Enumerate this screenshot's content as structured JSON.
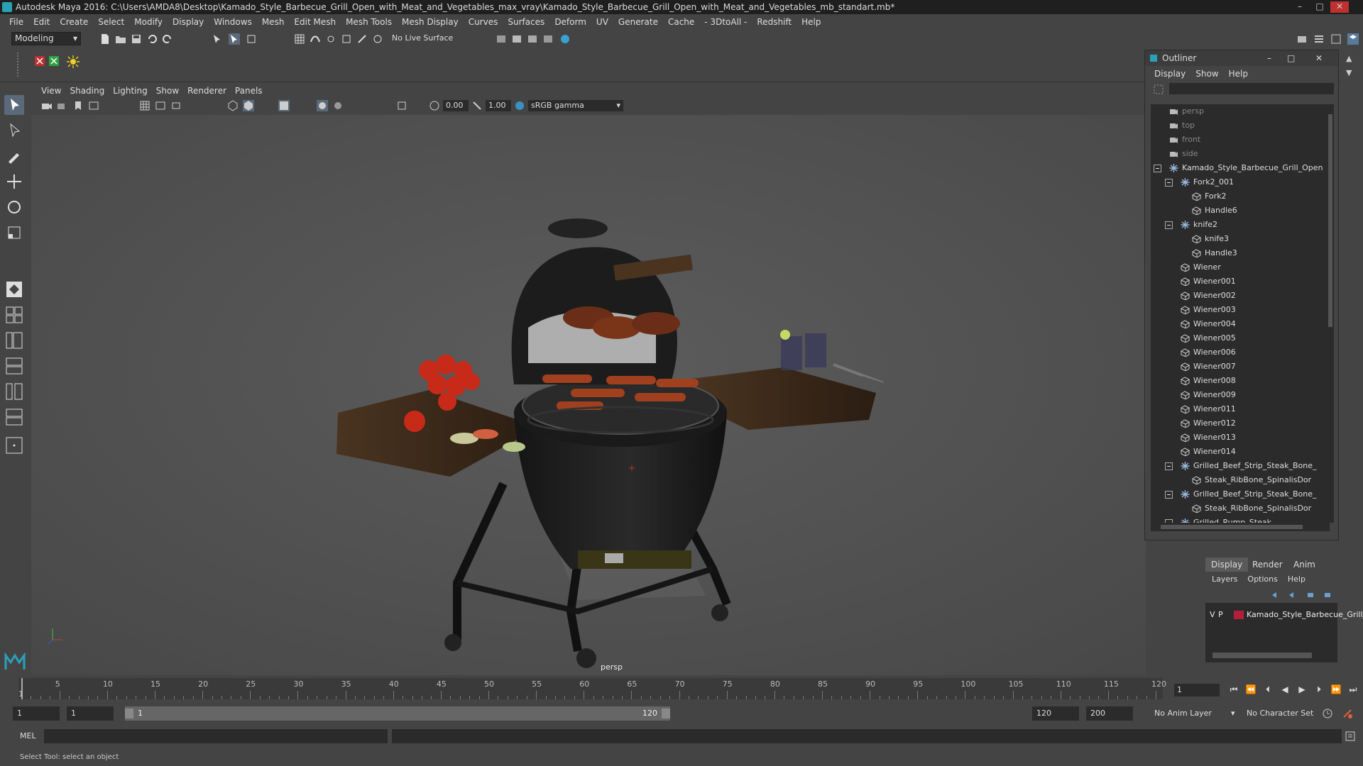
{
  "titlebar": {
    "title": "Autodesk Maya 2016: C:\\Users\\AMDA8\\Desktop\\Kamado_Style_Barbecue_Grill_Open_with_Meat_and_Vegetables_max_vray\\Kamado_Style_Barbecue_Grill_Open_with_Meat_and_Vegetables_mb_standart.mb*",
    "minimize": "–",
    "maximize": "□",
    "close": "✕"
  },
  "menubar": [
    "File",
    "Edit",
    "Create",
    "Select",
    "Modify",
    "Display",
    "Windows",
    "Mesh",
    "Edit Mesh",
    "Mesh Tools",
    "Mesh Display",
    "Curves",
    "Surfaces",
    "Deform",
    "UV",
    "Generate",
    "Cache",
    "- 3DtoAll -",
    "Redshift",
    "Help"
  ],
  "statusline": {
    "mode": "Modeling",
    "live_surface": "No Live Surface"
  },
  "viewport": {
    "menu": [
      "View",
      "Shading",
      "Lighting",
      "Show",
      "Renderer",
      "Panels"
    ],
    "exposure": "0.00",
    "gamma": "1.00",
    "color_space": "sRGB gamma",
    "camera_label": "persp"
  },
  "outliner": {
    "title": "Outliner",
    "menu": [
      "Display",
      "Show",
      "Help"
    ],
    "items": [
      {
        "label": "persp",
        "indent": 0,
        "type": "camera",
        "dim": true
      },
      {
        "label": "top",
        "indent": 0,
        "type": "camera",
        "dim": true
      },
      {
        "label": "front",
        "indent": 0,
        "type": "camera",
        "dim": true
      },
      {
        "label": "side",
        "indent": 0,
        "type": "camera",
        "dim": true
      },
      {
        "label": "Kamado_Style_Barbecue_Grill_Open",
        "indent": 0,
        "type": "group",
        "expanded": true
      },
      {
        "label": "Fork2_001",
        "indent": 1,
        "type": "group",
        "expanded": true
      },
      {
        "label": "Fork2",
        "indent": 2,
        "type": "mesh"
      },
      {
        "label": "Handle6",
        "indent": 2,
        "type": "mesh"
      },
      {
        "label": "knife2",
        "indent": 1,
        "type": "group",
        "expanded": true
      },
      {
        "label": "knife3",
        "indent": 2,
        "type": "mesh"
      },
      {
        "label": "Handle3",
        "indent": 2,
        "type": "mesh"
      },
      {
        "label": "Wiener",
        "indent": 1,
        "type": "mesh"
      },
      {
        "label": "Wiener001",
        "indent": 1,
        "type": "mesh"
      },
      {
        "label": "Wiener002",
        "indent": 1,
        "type": "mesh"
      },
      {
        "label": "Wiener003",
        "indent": 1,
        "type": "mesh"
      },
      {
        "label": "Wiener004",
        "indent": 1,
        "type": "mesh"
      },
      {
        "label": "Wiener005",
        "indent": 1,
        "type": "mesh"
      },
      {
        "label": "Wiener006",
        "indent": 1,
        "type": "mesh"
      },
      {
        "label": "Wiener007",
        "indent": 1,
        "type": "mesh"
      },
      {
        "label": "Wiener008",
        "indent": 1,
        "type": "mesh"
      },
      {
        "label": "Wiener009",
        "indent": 1,
        "type": "mesh"
      },
      {
        "label": "Wiener011",
        "indent": 1,
        "type": "mesh"
      },
      {
        "label": "Wiener012",
        "indent": 1,
        "type": "mesh"
      },
      {
        "label": "Wiener013",
        "indent": 1,
        "type": "mesh"
      },
      {
        "label": "Wiener014",
        "indent": 1,
        "type": "mesh"
      },
      {
        "label": "Grilled_Beef_Strip_Steak_Bone_",
        "indent": 1,
        "type": "group",
        "expanded": true
      },
      {
        "label": "Steak_RibBone_SpinalisDor",
        "indent": 2,
        "type": "mesh"
      },
      {
        "label": "Grilled_Beef_Strip_Steak_Bone_",
        "indent": 1,
        "type": "group",
        "expanded": true
      },
      {
        "label": "Steak_RibBone_SpinalisDor",
        "indent": 2,
        "type": "mesh"
      },
      {
        "label": "Grilled_Rump_Steak",
        "indent": 1,
        "type": "group",
        "expanded": true
      }
    ]
  },
  "layer_editor": {
    "tabs": [
      "Display",
      "Render",
      "Anim"
    ],
    "menu": [
      "Layers",
      "Options",
      "Help"
    ],
    "layer": {
      "v": "V",
      "p": "P",
      "name": "Kamado_Style_Barbecue_Grill_",
      "color": "#b0203a"
    }
  },
  "timeline": {
    "ticks": [
      5,
      10,
      15,
      20,
      25,
      30,
      35,
      40,
      45,
      50,
      55,
      60,
      65,
      70,
      75,
      80,
      85,
      90,
      95,
      100,
      105,
      110,
      115,
      120
    ],
    "start_label": "1",
    "current_frame": "1"
  },
  "range": {
    "start": "1",
    "playback_start": "1",
    "range_start_label": "1",
    "range_end_label": "120",
    "playback_end": "120",
    "end": "200",
    "anim_layer": "No Anim Layer",
    "character_set": "No Character Set"
  },
  "cmdline": {
    "label": "MEL"
  },
  "helpline": {
    "text": "Select Tool: select an object"
  },
  "colors": {
    "accent": "#5a6a7a",
    "maya_teal": "#2aa0b8",
    "layer_red": "#b0203a"
  }
}
